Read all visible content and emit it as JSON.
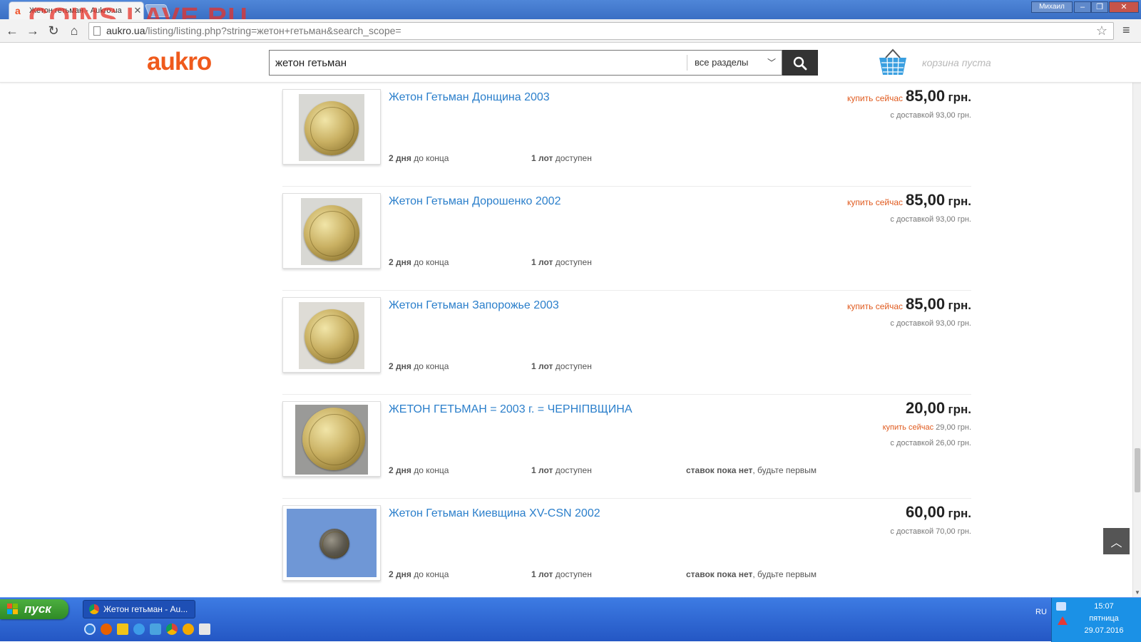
{
  "browser": {
    "tab_title": "Жетон гетьман - Aukro.ua",
    "tab_close": "✕",
    "watermark": "COINS.LAVE.RU",
    "user": "Михаил",
    "url_host": "aukro.ua",
    "url_path": "/listing/listing.php?string=жетон+гетьман&search_scope="
  },
  "site": {
    "logo": "aukro",
    "search_value": "жетон гетьман",
    "scope_label": "все разделы",
    "basket_text": "корзина пуста"
  },
  "items": [
    {
      "title": "Жетон Гетьман Донщина 2003",
      "time_bold": "2 дня",
      "time_rest": "до конца",
      "lots_bold": "1 лот",
      "lots_rest": "доступен",
      "price_label": "купить сейчас",
      "price": "85,00",
      "currency": "грн.",
      "delivery": "с доставкой 93,00 грн."
    },
    {
      "title": "Жетон Гетьман Дорошенко 2002",
      "time_bold": "2 дня",
      "time_rest": "до конца",
      "lots_bold": "1 лот",
      "lots_rest": "доступен",
      "price_label": "купить сейчас",
      "price": "85,00",
      "currency": "грн.",
      "delivery": "с доставкой 93,00 грн."
    },
    {
      "title": "Жетон Гетьман Запорожье 2003",
      "time_bold": "2 дня",
      "time_rest": "до конца",
      "lots_bold": "1 лот",
      "lots_rest": "доступен",
      "price_label": "купить сейчас",
      "price": "85,00",
      "currency": "грн.",
      "delivery": "с доставкой 93,00 грн."
    },
    {
      "title": "ЖЕТОН ГЕТЬМАН = 2003 г. = ЧЕРНІПВЩИНА",
      "time_bold": "2 дня",
      "time_rest": "до конца",
      "lots_bold": "1 лот",
      "lots_rest": "доступен",
      "bids_bold": "ставок пока нет",
      "bids_rest": ", будьте первым",
      "price": "20,00",
      "currency": "грн.",
      "buy_now_small": "купить сейчас",
      "buy_now_price": "29,00 грн.",
      "delivery": "с доставкой 26,00 грн."
    },
    {
      "title": "Жетон Гетьман Киевщина XV-CSN 2002",
      "time_bold": "2 дня",
      "time_rest": "до конца",
      "lots_bold": "1 лот",
      "lots_rest": "доступен",
      "bids_bold": "ставок пока нет",
      "bids_rest": ", будьте первым",
      "price": "60,00",
      "currency": "грн.",
      "delivery": "с доставкой 70,00 грн."
    }
  ],
  "taskbar": {
    "start_label": "пуск",
    "task_title": "Жетон гетьман - Au...",
    "lang": "RU",
    "time": "15:07",
    "weekday": "пятница",
    "date": "29.07.2016"
  },
  "colors": {
    "link": "#2b7fcb",
    "accent_orange": "#e05a1e",
    "logo": "#ef5a1c"
  }
}
